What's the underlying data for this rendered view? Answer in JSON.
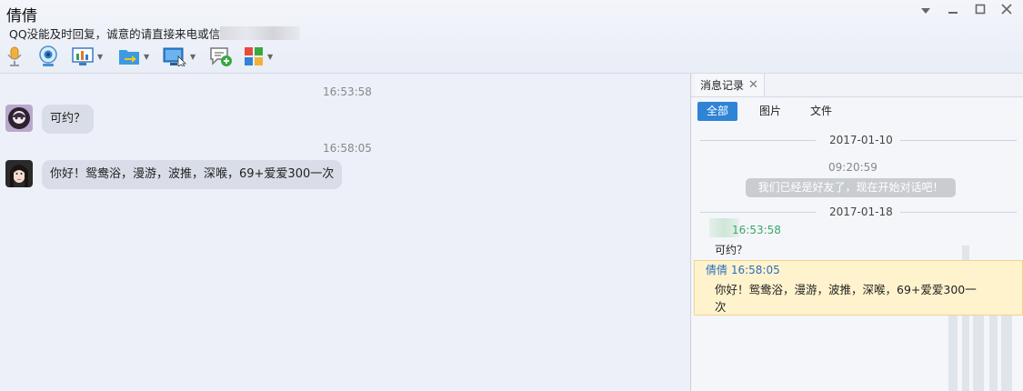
{
  "window": {
    "title": "倩倩",
    "signature": "QQ没能及时回复，诚意的请直接来电或信息",
    "controls": [
      "dropdown",
      "minimize",
      "maximize",
      "close"
    ]
  },
  "toolbar": {
    "items": [
      {
        "icon": "microphone-icon"
      },
      {
        "icon": "webcam-icon"
      },
      {
        "icon": "remote-desktop-icon",
        "dropdown": true
      },
      {
        "icon": "file-transfer-icon",
        "dropdown": true
      },
      {
        "icon": "screen-share-icon",
        "dropdown": true
      },
      {
        "icon": "new-message-icon"
      },
      {
        "icon": "apps-icon",
        "dropdown": true
      }
    ]
  },
  "chat": {
    "messages": [
      {
        "time": "16:53:58",
        "text": "可约？",
        "sender": "self"
      },
      {
        "time": "16:58:05",
        "text": "你好！鸳鸯浴，漫游，波推，深喉，69+爱爱300一次",
        "sender": "contact"
      }
    ]
  },
  "history": {
    "tab_label": "消息记录",
    "filters": [
      "全部",
      "图片",
      "文件"
    ],
    "active_filter": "全部",
    "entries": [
      {
        "date": "2017-01-10"
      },
      {
        "time": "09:20:59",
        "system_text": "我们已经是好友了，现在开始对话吧！"
      },
      {
        "date": "2017-01-18"
      },
      {
        "sender": "",
        "time": "16:53:58",
        "text": "可约？"
      },
      {
        "sender": "倩倩",
        "time": "16:58:05",
        "text_line1": "你好！鸳鸯浴，漫游，波推，深喉，69+爱爱300一",
        "text_line2": "次",
        "highlighted": true
      }
    ]
  },
  "colors": {
    "accent": "#2f84d6",
    "self_time": "#3aa86a",
    "contact_time": "#2a6fc0",
    "highlight_bg": "#fff3cd",
    "bubble_bg": "#d8dde7"
  }
}
